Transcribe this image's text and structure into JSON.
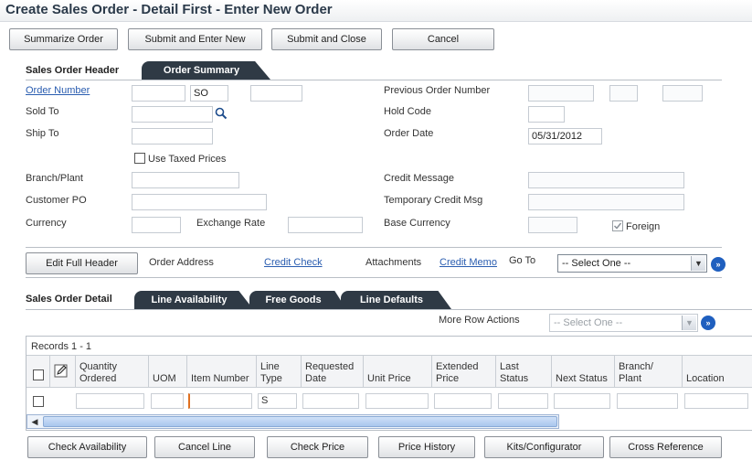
{
  "title": "Create Sales Order - Detail First - Enter New Order",
  "toolbar": {
    "summarize": "Summarize Order",
    "submit_new": "Submit and Enter New",
    "submit_close": "Submit and Close",
    "cancel": "Cancel"
  },
  "header": {
    "section_label": "Sales Order Header",
    "tab_order_summary": "Order Summary",
    "order_number_label": "Order Number",
    "order_type_value": "SO",
    "sold_to_label": "Sold To",
    "ship_to_label": "Ship To",
    "use_taxed_prices": "Use Taxed Prices",
    "branch_plant_label": "Branch/Plant",
    "customer_po_label": "Customer PO",
    "currency_label": "Currency",
    "exchange_rate_label": "Exchange Rate",
    "previous_order_label": "Previous Order Number",
    "hold_code_label": "Hold Code",
    "order_date_label": "Order Date",
    "order_date_value": "05/31/2012",
    "credit_message_label": "Credit Message",
    "temp_credit_label": "Temporary Credit Msg",
    "base_currency_label": "Base Currency",
    "foreign_label": "Foreign"
  },
  "links_row": {
    "edit_full_header": "Edit Full Header",
    "order_address": "Order Address",
    "credit_check": "Credit Check",
    "attachments": "Attachments",
    "credit_memo": "Credit Memo",
    "go_to": "Go To",
    "select_one": "-- Select One --"
  },
  "detail": {
    "section_label": "Sales Order Detail",
    "tab_line_availability": "Line Availability",
    "tab_free_goods": "Free Goods",
    "tab_line_defaults": "Line Defaults",
    "more_row_actions": "More Row Actions",
    "select_one": "-- Select One --",
    "records": "Records 1 - 1",
    "columns": [
      "Quantity Ordered",
      "UOM",
      "Item Number",
      "Line Type",
      "Requested Date",
      "Unit Price",
      "Extended Price",
      "Last Status",
      "Next Status",
      "Branch/ Plant",
      "Location"
    ],
    "row_line_type": "S"
  },
  "bottom_buttons": {
    "check_availability": "Check Availability",
    "cancel_line": "Cancel Line",
    "check_price": "Check Price",
    "price_history": "Price History",
    "kits": "Kits/Configurator",
    "cross_reference": "Cross Reference"
  }
}
